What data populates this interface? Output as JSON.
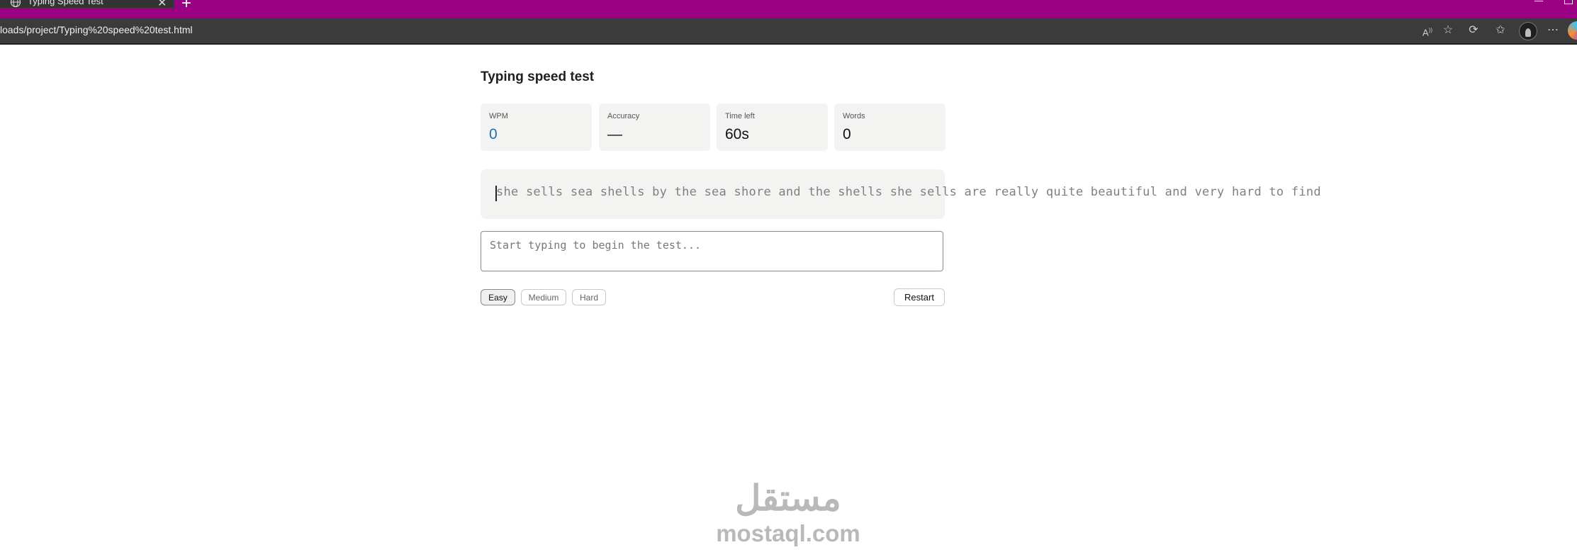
{
  "browser": {
    "tab_title": "Typing Speed Test",
    "new_tab_symbol": "+",
    "url": "loads/project/Typing%20speed%20test.html",
    "accent_color": "#9a0084"
  },
  "app": {
    "title": "Typing speed test",
    "stats": [
      {
        "label": "WPM",
        "value": "0"
      },
      {
        "label": "Accuracy",
        "value": "—"
      },
      {
        "label": "Time left",
        "value": "60s"
      },
      {
        "label": "Words",
        "value": "0"
      }
    ],
    "passage": "she sells sea shells by the sea shore and the shells she sells are really quite beautiful and very hard to find",
    "input": {
      "placeholder": "Start typing to begin the test...",
      "value": ""
    },
    "difficulty": {
      "options": [
        "Easy",
        "Medium",
        "Hard"
      ],
      "selected": "Easy"
    },
    "restart_label": "Restart"
  },
  "watermark": {
    "arabic": "مستقل",
    "latin": "mostaql.com"
  }
}
